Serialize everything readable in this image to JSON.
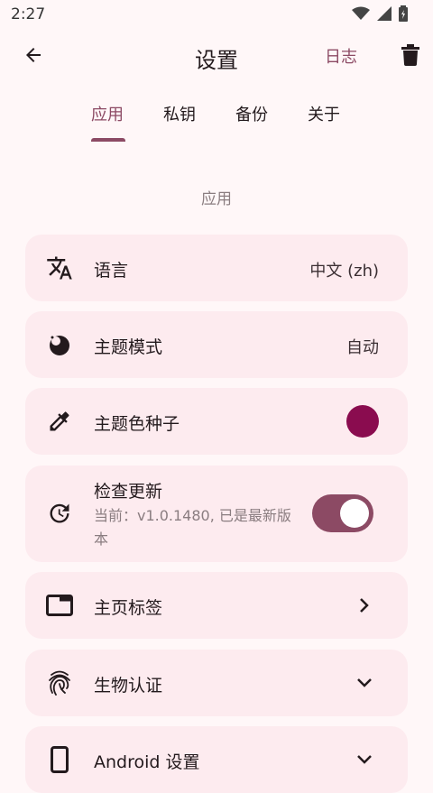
{
  "status_bar": {
    "time": "2:27"
  },
  "app_bar": {
    "title": "设置",
    "log_label": "日志"
  },
  "tabs": [
    {
      "label": "应用",
      "active": true
    },
    {
      "label": "私钥",
      "active": false
    },
    {
      "label": "备份",
      "active": false
    },
    {
      "label": "关于",
      "active": false
    }
  ],
  "section": {
    "title": "应用"
  },
  "settings": {
    "language": {
      "label": "语言",
      "value": "中文 (zh)"
    },
    "theme_mode": {
      "label": "主题模式",
      "value": "自动"
    },
    "theme_seed": {
      "label": "主题色种子",
      "color": "#8a0c4f"
    },
    "check_update": {
      "label": "检查更新",
      "subtitle": "当前：v1.0.1480, 已是最新版本",
      "enabled": true
    },
    "home_tabs": {
      "label": "主页标签"
    },
    "biometric": {
      "label": "生物认证"
    },
    "android": {
      "label": "Android 设置"
    }
  },
  "colors": {
    "accent": "#8c4a64",
    "card_bg": "#fdebef",
    "page_bg": "#fff7f8"
  }
}
